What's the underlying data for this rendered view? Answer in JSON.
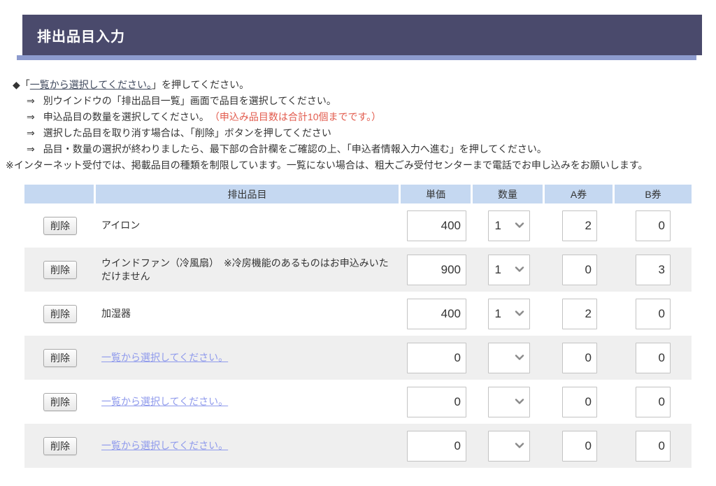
{
  "page": {
    "title": "排出品目入力"
  },
  "instructions": {
    "bullet_prefix": "◆「",
    "lead_link": "一覧から選択してください。",
    "lead_suffix": "」を押してください。",
    "arrow": "⇒",
    "steps": [
      {
        "text": "別ウインドウの「排出品目一覧」画面で品目を選択してください。",
        "note": ""
      },
      {
        "text": "申込品目の数量を選択してください。",
        "note": "（申込み品目数は合計10個までです。）"
      },
      {
        "text": "選択した品目を取り消す場合は、「削除」ボタンを押してください",
        "note": ""
      },
      {
        "text": "品目・数量の選択が終わりましたら、最下部の合計欄をご確認の上、「申込者情報入力へ進む」を押してください。",
        "note": ""
      }
    ],
    "note": "※インターネット受付では、掲載品目の種類を制限しています。一覧にない場合は、粗大ごみ受付センターまで電話でお申し込みをお願いします。"
  },
  "table": {
    "headers": {
      "item": "排出品目",
      "unit_price": "単価",
      "quantity": "数量",
      "ticket_a": "A券",
      "ticket_b": "B券"
    },
    "delete_label": "削除",
    "placeholder_link": "一覧から選択してください。",
    "rows": [
      {
        "type": "item",
        "name": "アイロン",
        "unit_price": "400",
        "quantity": "1",
        "ticket_a": "2",
        "ticket_b": "0"
      },
      {
        "type": "item",
        "name": "ウインドファン（冷風扇）　※冷房機能のあるものはお申込みいただけません",
        "unit_price": "900",
        "quantity": "1",
        "ticket_a": "0",
        "ticket_b": "3"
      },
      {
        "type": "item",
        "name": "加湿器",
        "unit_price": "400",
        "quantity": "1",
        "ticket_a": "2",
        "ticket_b": "0"
      },
      {
        "type": "empty",
        "name": "",
        "unit_price": "0",
        "quantity": "",
        "ticket_a": "0",
        "ticket_b": "0"
      },
      {
        "type": "empty",
        "name": "",
        "unit_price": "0",
        "quantity": "",
        "ticket_a": "0",
        "ticket_b": "0"
      },
      {
        "type": "empty",
        "name": "",
        "unit_price": "0",
        "quantity": "",
        "ticket_a": "0",
        "ticket_b": "0"
      }
    ]
  },
  "icons": {
    "quantity_dropdown": "chevron-down-icon"
  },
  "colors": {
    "title_bar": "#4a4a6c",
    "title_strip": "#8d9bce",
    "table_header_bg": "#c5d8f1",
    "row_alt_bg": "#efefef",
    "warning_red": "#e25a4c",
    "row_link": "#8f9aec",
    "instruction_link": "#404a5e"
  }
}
